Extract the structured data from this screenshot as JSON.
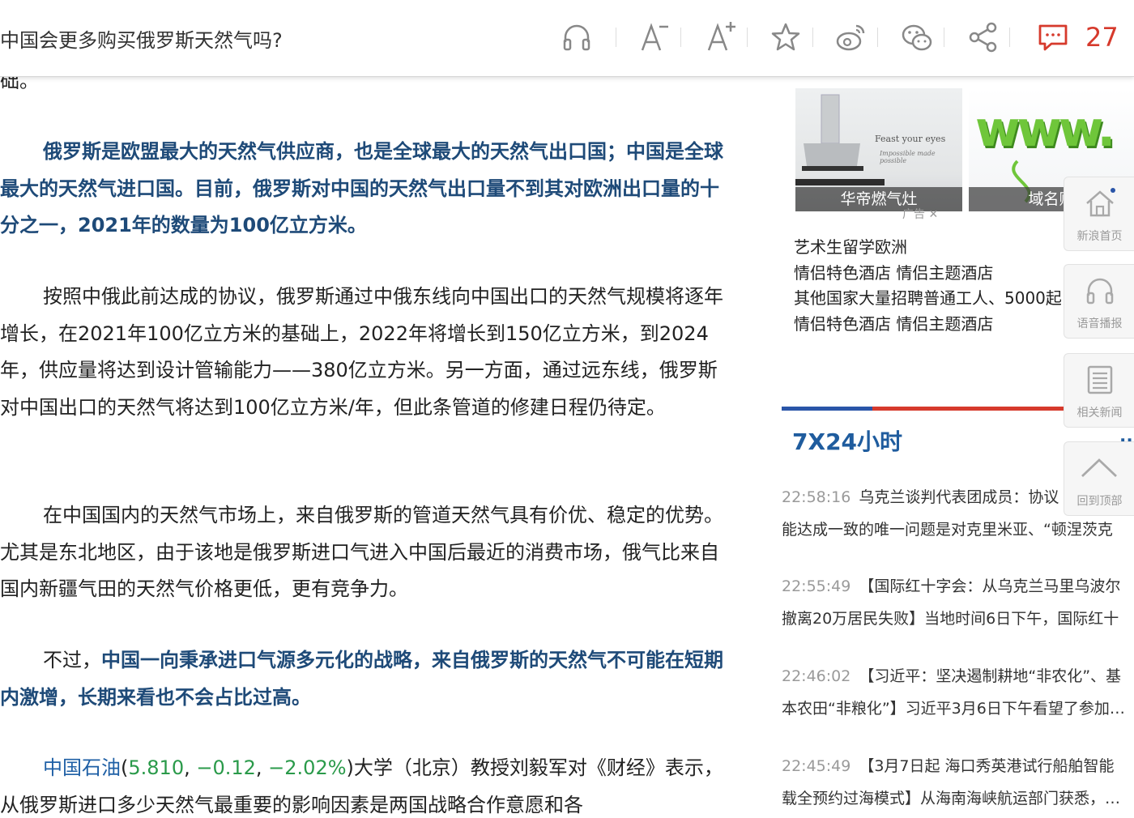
{
  "topbar": {
    "title": "中国会更多购买俄罗斯天然气吗?",
    "comment_count": "27",
    "icons": [
      "headphones-icon",
      "font-decrease-icon",
      "font-increase-icon",
      "star-icon",
      "weibo-icon",
      "wechat-icon",
      "share-icon",
      "comment-icon"
    ]
  },
  "article": {
    "top_fragment": "础。",
    "p1": "俄罗斯是欧盟最大的天然气供应商，也是全球最大的天然气出口国；中国是全球最大的天然气进口国。目前，俄罗斯对中国的天然气出口量不到其对欧洲出口量的十分之一，2021年的数量为100亿立方米。",
    "p2": "按照中俄此前达成的协议，俄罗斯通过中俄东线向中国出口的天然气规模将逐年增长，在2021年100亿立方米的基础上，2022年将增长到150亿立方米，到2024年，供应量将达到设计管输能力——380亿立方米。另一方面，通过远东线，俄罗斯对中国出口的天然气将达到100亿立方米/年，但此条管道的修建日程仍待定。",
    "p3": "在中国国内的天然气市场上，来自俄罗斯的管道天然气具有价优、稳定的优势。尤其是东北地区，由于该地是俄罗斯进口气进入中国后最近的消费市场，俄气比来自国内新疆气田的天然气价格更低，更有竞争力。",
    "p4_lead": "不过，",
    "p4_bold": "中国一向秉承进口气源多元化的战略，来自俄罗斯的天然气不可能在短期内激增，长期来看也不会占比过高。",
    "p5_link": "中国石油",
    "p5_open": "(",
    "p5_price": "5.810",
    "p5_c1": ", ",
    "p5_change": "−0.12",
    "p5_c2": ", ",
    "p5_pct": "−2.02%",
    "p5_close": ")",
    "p5_rest": "大学（北京）教授刘毅军对《财经》表示，从俄罗斯进口多少天然气最重要的影响因素是两国战略合作意愿和各"
  },
  "sidebar": {
    "ad1": {
      "caption": "华帝燃气灶",
      "image_text": "Feast your eyes",
      "image_script": "Impossible made possible"
    },
    "ad2": {
      "caption": "域名购",
      "image_text": "www."
    },
    "ad_tag": "广告",
    "ad_links": [
      "艺术生留学欧洲",
      "情侣特色酒店 情侣主题酒店",
      "其他国家大量招聘普通工人、5000起",
      "情侣特色酒店 情侣主题酒店"
    ],
    "section_title": "7X24小时",
    "news": [
      {
        "time": "22:58:16",
        "line1": "乌克兰谈判代表团成员：协议",
        "line2": "能达成一致的唯一问题是对克里米亚、“顿涅茨克"
      },
      {
        "time": "22:55:49",
        "line1": "【国际红十字会：从乌克兰马里乌波尔",
        "line2": "撤离20万居民失败】当地时间6日下午，国际红十"
      },
      {
        "time": "22:46:02",
        "line1": "【习近平：坚决遏制耕地“非农化”、基",
        "line2": "本农田“非粮化”】习近平3月6日下午看望了参加…"
      },
      {
        "time": "22:45:49",
        "line1": "【3月7日起 海口秀英港试行船舶智能",
        "line2": "载全预约过海模式】从海南海峡航运部门获悉，…"
      }
    ],
    "float_buttons": [
      "新浪首页",
      "语音播报",
      "相关新闻",
      "回到顶部"
    ]
  },
  "colors": {
    "accent_red": "#d63a2c",
    "title_blue": "#1f5c9e",
    "bold_blue": "#1e4a78",
    "stock_green": "#2a9a4a"
  }
}
